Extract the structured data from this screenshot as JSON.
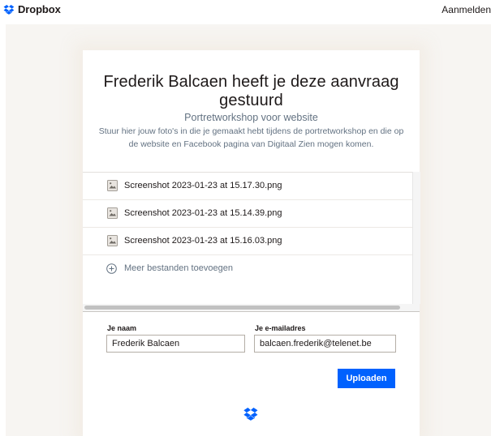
{
  "header": {
    "brand": "Dropbox",
    "signin_label": "Aanmelden"
  },
  "request": {
    "title": "Frederik Balcaen heeft je deze aanvraag gestuurd",
    "subtitle": "Portretworkshop voor website",
    "description": "Stuur hier jouw foto's in die je gemaakt hebt tijdens de portretworkshop en die op de website en Facebook pagina van Digitaal Zien mogen komen."
  },
  "files": [
    {
      "name": "Screenshot 2023-01-23 at 15.17.30.png",
      "icon": "image-file-icon"
    },
    {
      "name": "Screenshot 2023-01-23 at 15.14.39.png",
      "icon": "image-file-icon"
    },
    {
      "name": "Screenshot 2023-01-23 at 15.16.03.png",
      "icon": "image-file-icon"
    }
  ],
  "add_more_label": "Meer bestanden toevoegen",
  "form": {
    "name_label": "Je naam",
    "name_value": "Frederik Balcaen",
    "email_label": "Je e-mailadres",
    "email_value": "balcaen.frederik@telenet.be",
    "submit_label": "Uploaden"
  },
  "colors": {
    "accent": "#0061fe",
    "page_background": "#f7f5f2",
    "secondary_text": "#637282"
  }
}
